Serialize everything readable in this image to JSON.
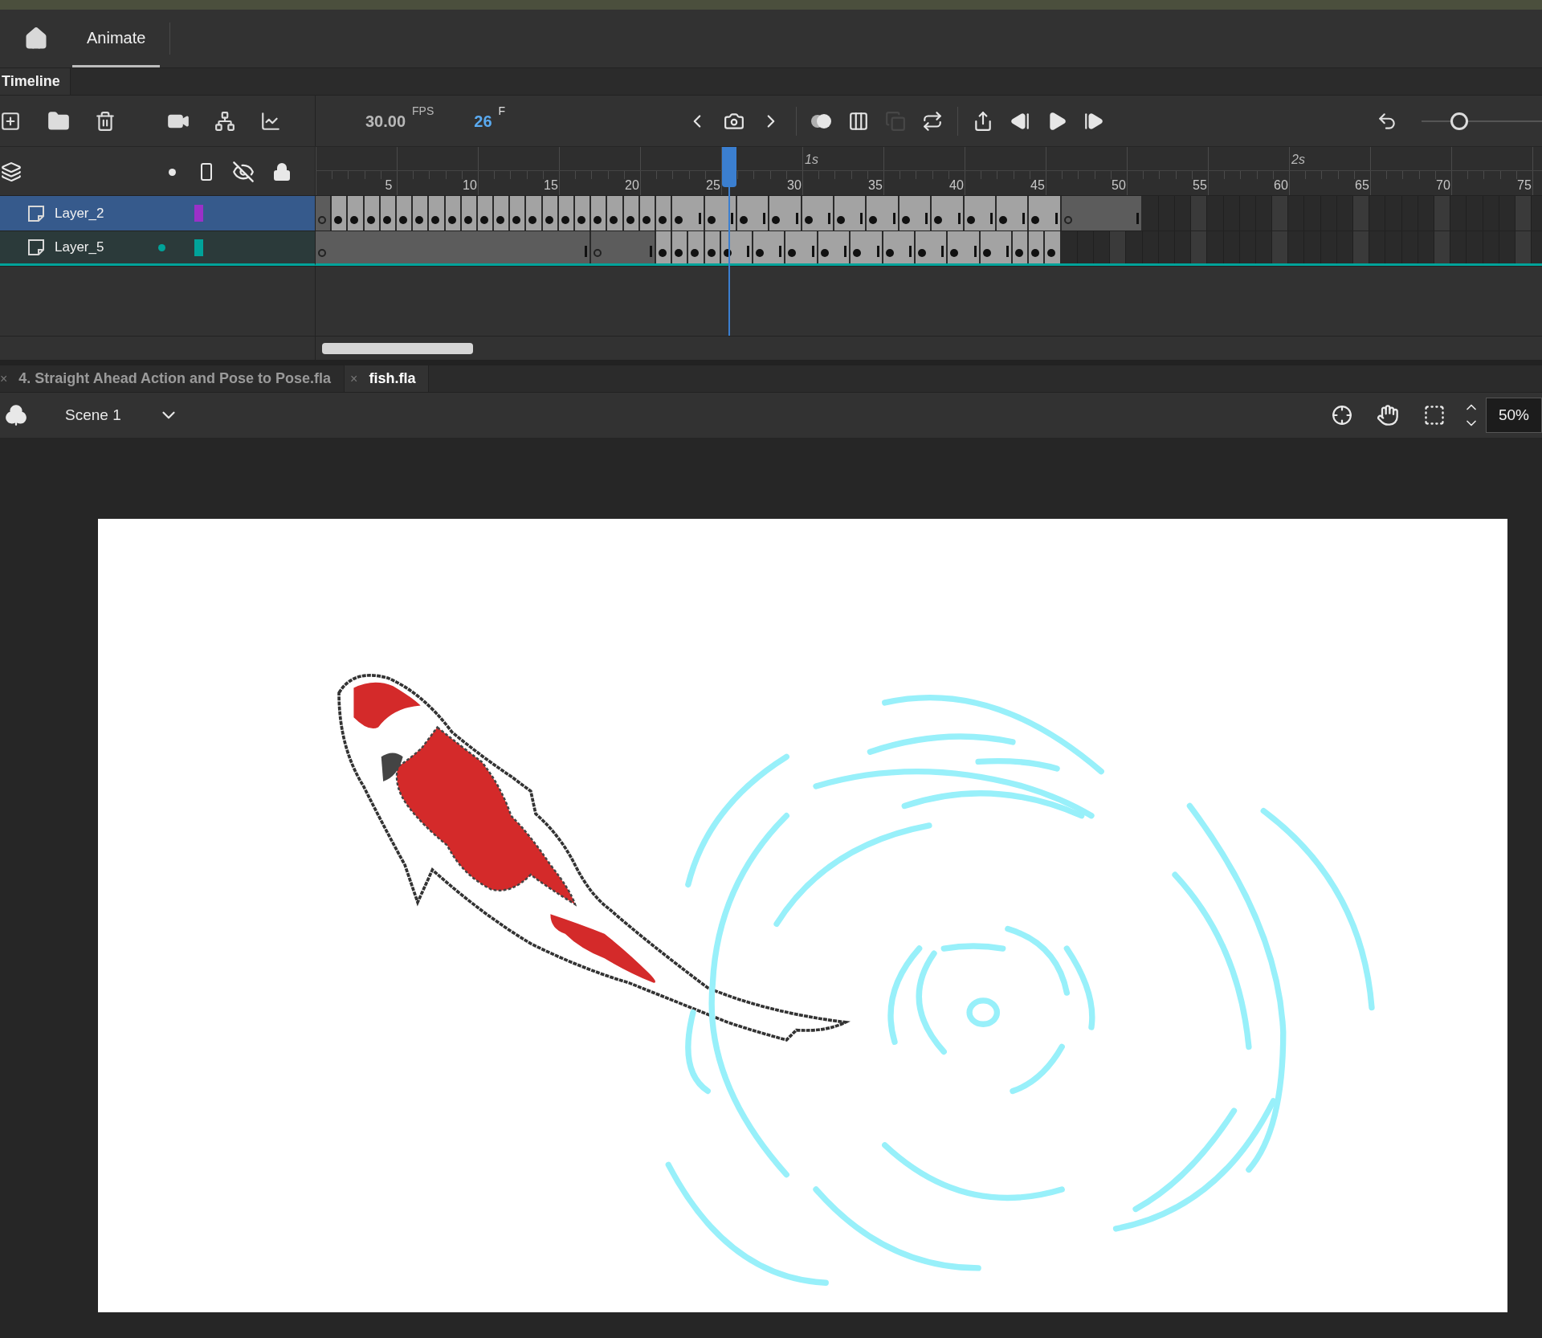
{
  "header": {
    "tab": "Animate"
  },
  "timeline": {
    "title": "Timeline",
    "fps": "30.00",
    "fps_unit": "FPS",
    "frame": "26",
    "frame_unit": "F",
    "playback_groups": [
      {
        "tools": [
          {
            "kind": "prev",
            "disabled": false
          },
          {
            "kind": "keyframe",
            "disabled": false
          },
          {
            "kind": "next",
            "disabled": false
          }
        ]
      },
      {
        "tools": [
          {
            "kind": "onion",
            "disabled": false
          },
          {
            "kind": "multi",
            "disabled": false
          },
          {
            "kind": "copy",
            "disabled": true
          },
          {
            "kind": "loop",
            "disabled": false
          }
        ]
      },
      {
        "tools": [
          {
            "kind": "export",
            "disabled": false
          },
          {
            "kind": "step_back",
            "disabled": false
          },
          {
            "kind": "play",
            "disabled": false
          },
          {
            "kind": "step_forward",
            "disabled": false
          }
        ]
      }
    ],
    "zoom_slider": {
      "level": 0.31
    },
    "ruler": {
      "seconds": [
        "1s",
        "2s"
      ],
      "labels": [
        "5",
        "10",
        "15",
        "20",
        "25",
        "30",
        "35",
        "40",
        "45",
        "50",
        "55",
        "60",
        "65",
        "70",
        "75"
      ]
    },
    "layers": [
      {
        "name": "Layer_2",
        "selected": true,
        "highlighted": false,
        "color": "#9b30c8",
        "frames": [
          {
            "kind": "blank_key"
          },
          {
            "kind": "key"
          },
          {
            "kind": "key"
          },
          {
            "kind": "key"
          },
          {
            "kind": "key"
          },
          {
            "kind": "key"
          },
          {
            "kind": "key"
          },
          {
            "kind": "key"
          },
          {
            "kind": "key"
          },
          {
            "kind": "key"
          },
          {
            "kind": "key"
          },
          {
            "kind": "key"
          },
          {
            "kind": "key"
          },
          {
            "kind": "key"
          },
          {
            "kind": "key"
          },
          {
            "kind": "key"
          },
          {
            "kind": "key"
          },
          {
            "kind": "key"
          },
          {
            "kind": "key"
          },
          {
            "kind": "key"
          },
          {
            "kind": "key"
          },
          {
            "kind": "key"
          },
          {
            "kind": "key"
          },
          {
            "kind": "end"
          },
          {
            "kind": "key"
          },
          {
            "kind": "end"
          },
          {
            "kind": "key"
          },
          {
            "kind": "end"
          },
          {
            "kind": "key"
          },
          {
            "kind": "end"
          },
          {
            "kind": "key"
          },
          {
            "kind": "end"
          },
          {
            "kind": "key"
          },
          {
            "kind": "end"
          },
          {
            "kind": "key"
          },
          {
            "kind": "end"
          },
          {
            "kind": "key"
          },
          {
            "kind": "end"
          },
          {
            "kind": "key"
          },
          {
            "kind": "end"
          },
          {
            "kind": "key"
          },
          {
            "kind": "end"
          },
          {
            "kind": "key"
          },
          {
            "kind": "end"
          },
          {
            "kind": "key"
          },
          {
            "kind": "end"
          },
          {
            "kind": "blank_key"
          },
          {
            "kind": "hold"
          },
          {
            "kind": "hold"
          },
          {
            "kind": "hold"
          },
          {
            "kind": "end"
          }
        ]
      },
      {
        "name": "Layer_5",
        "selected": false,
        "highlighted": true,
        "color": "#00a39a",
        "frames": [
          {
            "kind": "blank_key"
          },
          {
            "kind": "hold"
          },
          {
            "kind": "hold"
          },
          {
            "kind": "hold"
          },
          {
            "kind": "hold"
          },
          {
            "kind": "hold"
          },
          {
            "kind": "hold"
          },
          {
            "kind": "hold"
          },
          {
            "kind": "hold"
          },
          {
            "kind": "hold"
          },
          {
            "kind": "hold"
          },
          {
            "kind": "hold"
          },
          {
            "kind": "hold"
          },
          {
            "kind": "hold"
          },
          {
            "kind": "hold"
          },
          {
            "kind": "hold"
          },
          {
            "kind": "end"
          },
          {
            "kind": "blank_key"
          },
          {
            "kind": "hold"
          },
          {
            "kind": "hold"
          },
          {
            "kind": "end"
          },
          {
            "kind": "key"
          },
          {
            "kind": "key"
          },
          {
            "kind": "key"
          },
          {
            "kind": "key"
          },
          {
            "kind": "key"
          },
          {
            "kind": "end"
          },
          {
            "kind": "key"
          },
          {
            "kind": "end"
          },
          {
            "kind": "key"
          },
          {
            "kind": "end"
          },
          {
            "kind": "key"
          },
          {
            "kind": "end"
          },
          {
            "kind": "key"
          },
          {
            "kind": "end"
          },
          {
            "kind": "key"
          },
          {
            "kind": "end"
          },
          {
            "kind": "key"
          },
          {
            "kind": "end"
          },
          {
            "kind": "key"
          },
          {
            "kind": "end"
          },
          {
            "kind": "key"
          },
          {
            "kind": "end"
          },
          {
            "kind": "key"
          },
          {
            "kind": "key"
          },
          {
            "kind": "key"
          }
        ]
      }
    ]
  },
  "documents": [
    {
      "close": "×",
      "title": "4. Straight Ahead Action and Pose to Pose.fla",
      "selected": false
    },
    {
      "close": "×",
      "title": "fish.fla",
      "selected": true
    }
  ],
  "scene": {
    "name": "Scene 1"
  },
  "zoom": {
    "value": "50%"
  }
}
